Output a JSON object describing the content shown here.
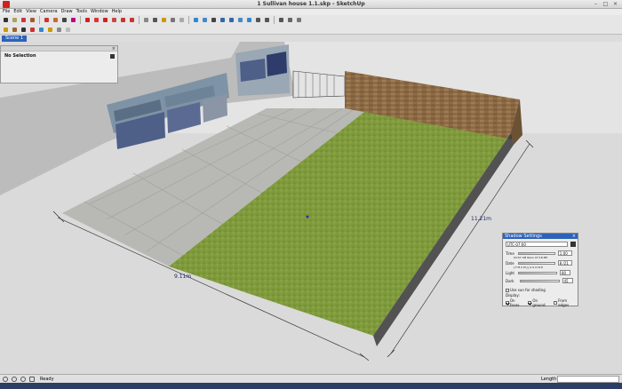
{
  "window": {
    "title": "1 Sullivan house 1.1.skp - SketchUp"
  },
  "menu": [
    "File",
    "Edit",
    "View",
    "Camera",
    "Draw",
    "Tools",
    "Window",
    "Help"
  ],
  "toolbar_icons": {
    "row1": [
      "select-icon",
      "eraser-icon",
      "line-icon",
      "arc-icon",
      "rectangle-icon",
      "circle-icon",
      "polygon-icon",
      "freehand-icon",
      "move-icon",
      "pushpull-icon",
      "rotate-icon",
      "followme-icon",
      "scale-icon",
      "offset-icon",
      "tape-icon",
      "dimension-icon",
      "protractor-icon",
      "text-icon",
      "axes-icon",
      "3dtext-icon",
      "orbit-icon",
      "pan-icon",
      "zoom-icon",
      "zoom-window-icon",
      "zoom-extents-icon",
      "previous-icon",
      "position-camera-icon",
      "walk-icon",
      "lookaround-icon",
      "section-icon",
      "get-models-icon",
      "share-model-icon",
      "components-icon"
    ],
    "row2": [
      "paint-icon",
      "materials-icon",
      "house-icon",
      "styles-icon",
      "layers-icon",
      "outliner-icon",
      "scenes-icon",
      "shadows-icon",
      "fog-icon"
    ]
  },
  "scene_tab": "Scene 1",
  "entity_info": {
    "selection": "No Selection"
  },
  "dimensions": {
    "width_label": "9.11m",
    "length_label": "11.21m"
  },
  "shadow_settings": {
    "title": "Shadow Settings",
    "timezone": "UTC-07:00",
    "time_label": "Time",
    "time_ticks": "04:57 AM  Noon  07:18 PM",
    "time_value": "1:00",
    "date_label": "Date",
    "date_ticks": "J F M A M J J A S O N D",
    "date_value": "8 /21",
    "light_label": "Light",
    "light_value": "80",
    "dark_label": "Dark",
    "dark_value": "45",
    "use_sun_label": "Use sun for shading",
    "display_label": "Display:",
    "on_faces_label": "On faces",
    "on_ground_label": "On ground",
    "from_edges_label": "From edges",
    "on_faces": true,
    "on_ground": true,
    "from_edges": false
  },
  "status": {
    "text": "Ready",
    "length_label": "Length",
    "length_value": ""
  },
  "colors": {
    "sky": "#e8e8e8",
    "ground": "#dcdcdc",
    "lawn": "#7f9a3c",
    "paving": "#b9bbb6",
    "brick": "#8a6a45",
    "selection_blue": "#2d62b8"
  }
}
